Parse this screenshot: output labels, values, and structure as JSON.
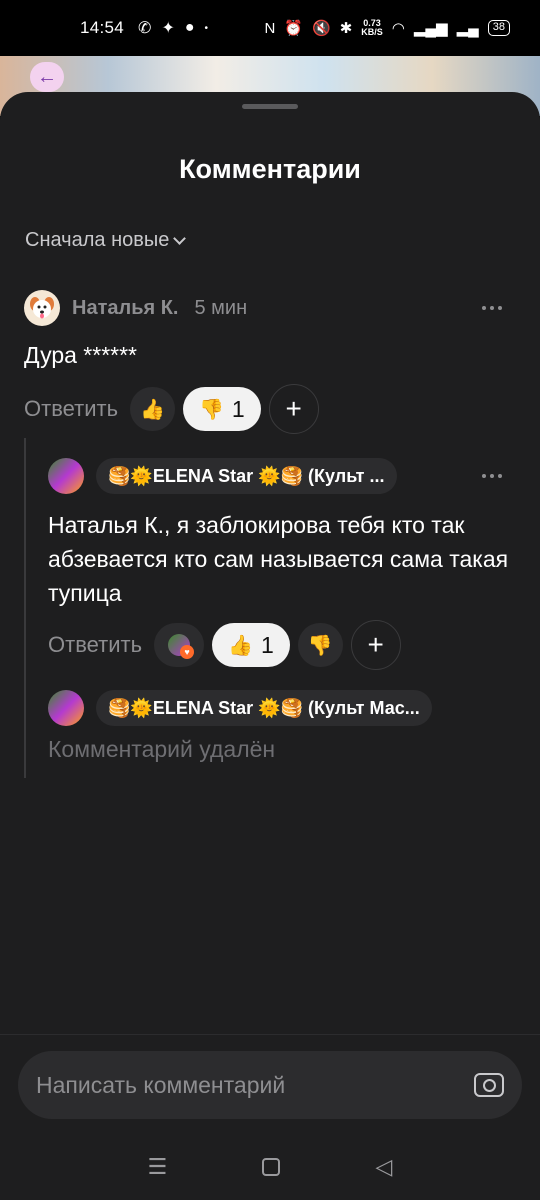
{
  "status_bar": {
    "time": "14:54",
    "speed_value": "0.73",
    "speed_unit": "KB/S",
    "battery": "38"
  },
  "sheet": {
    "title": "Комментарии",
    "sort_label": "Сначала новые"
  },
  "comments": [
    {
      "author": "Наталья К.",
      "time": "5 мин",
      "text": "Дура ******",
      "reply_label": "Ответить",
      "reactions": [
        {
          "icon": "thumbs-up-icon",
          "emoji": "👍",
          "count": ""
        },
        {
          "icon": "thumbs-down-icon",
          "emoji": "👎",
          "count": "1",
          "active": true
        }
      ]
    },
    {
      "author": "🥞🌞ELENA Star 🌞🥞 (Культ ...",
      "text": "Наталья К., я заблокирова тебя кто так абзевается кто сам называется сама такая тупица",
      "reply_label": "Ответить",
      "reactions": [
        {
          "icon": "thumbs-up-icon",
          "emoji": "👍",
          "count": "1",
          "active": true
        },
        {
          "icon": "thumbs-down-icon",
          "emoji": "👎",
          "count": ""
        }
      ]
    },
    {
      "author": "🥞🌞ELENA Star 🌞🥞 (Культ Мас...",
      "text": "Комментарий удалён"
    }
  ],
  "input": {
    "placeholder": "Написать комментарий"
  },
  "colors": {
    "sheet_bg": "#1e1e1f",
    "chip_bg": "#2c2c2e",
    "muted_text": "#8e8e91"
  }
}
